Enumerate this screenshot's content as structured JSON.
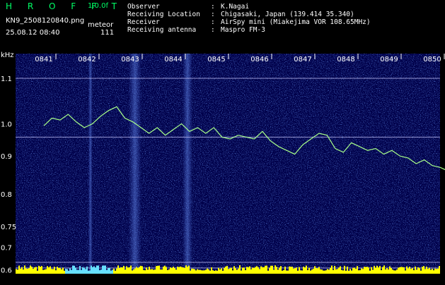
{
  "header": {
    "app_name": "H R O F F T",
    "version": "1.0.0f",
    "filename": "KN9_2508120840.png",
    "mode": "meteor",
    "date": "25.08.12 08:40",
    "count": "111"
  },
  "meta": [
    {
      "key": "Observer",
      "value": "K.Nagai"
    },
    {
      "key": "Receiving Location",
      "value": "Chigasaki, Japan (139.414 35.340)"
    },
    {
      "key": "Receiver",
      "value": "AirSpy mini (Miakejima VOR 108.65MHz)"
    },
    {
      "key": "Receiving antenna",
      "value": "Maspro FM-3"
    }
  ],
  "colors": {
    "background": "#00004a",
    "noise": "#3a66ff",
    "trace": "#a8ff8a",
    "text": "#ffffff",
    "accent": "#00ff66",
    "baseline": "#ffff00"
  },
  "chart_data": {
    "type": "heatmap",
    "ylabel": "kHz",
    "yticks": [
      "1.1",
      "1.0",
      "0.9",
      "0.8",
      "0.75",
      "0.7",
      "0.6"
    ],
    "xticks": [
      "0841",
      "0842",
      "0843",
      "0844",
      "0845",
      "0846",
      "0847",
      "0848",
      "0849",
      "0850"
    ],
    "ylim": [
      0.59,
      1.17
    ],
    "reference_lines_khz": [
      1.105,
      0.95,
      0.62,
      0.605
    ],
    "trace": {
      "x_minutes": [
        0.0,
        0.2,
        0.4,
        0.6,
        0.8,
        1.0,
        1.2,
        1.4,
        1.6,
        1.8,
        2.0,
        2.2,
        2.4,
        2.6,
        2.8,
        3.0,
        3.2,
        3.4,
        3.6,
        3.8,
        4.0,
        4.2,
        4.4,
        4.6,
        4.8,
        5.0,
        5.2,
        5.4,
        5.6,
        5.8,
        6.0,
        6.2,
        6.4,
        6.6,
        6.8,
        7.0,
        7.2,
        7.4,
        7.6,
        7.8,
        8.0,
        8.2,
        8.4,
        8.6,
        8.8,
        9.0,
        9.2,
        9.4,
        9.6,
        9.8,
        10.0
      ],
      "khz": [
        0.98,
        1.0,
        0.995,
        1.01,
        0.99,
        0.975,
        0.985,
        1.005,
        1.02,
        1.03,
        1.0,
        0.99,
        0.975,
        0.96,
        0.975,
        0.955,
        0.97,
        0.985,
        0.965,
        0.975,
        0.96,
        0.975,
        0.95,
        0.945,
        0.955,
        0.95,
        0.945,
        0.965,
        0.94,
        0.925,
        0.915,
        0.905,
        0.93,
        0.945,
        0.96,
        0.955,
        0.92,
        0.91,
        0.935,
        0.925,
        0.915,
        0.92,
        0.905,
        0.915,
        0.9,
        0.895,
        0.88,
        0.89,
        0.875,
        0.87,
        0.86
      ]
    }
  }
}
